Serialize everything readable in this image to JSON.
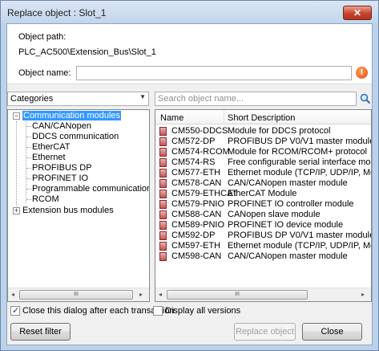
{
  "window": {
    "title": "Replace object : Slot_1",
    "close_label": "✕"
  },
  "header": {
    "path_label": "Object path:",
    "path_value": "PLC_AC500\\Extension_Bus\\Slot_1",
    "name_label": "Object name:",
    "name_value": "",
    "warning_symbol": "!"
  },
  "filter": {
    "category_selected": "Categories",
    "search_placeholder": "Search object name..."
  },
  "tree": {
    "nodes": [
      {
        "label": "Communication modules",
        "expanded": true,
        "selected": true
      },
      {
        "label": "CAN/CANopen"
      },
      {
        "label": "DDCS communication"
      },
      {
        "label": "EtherCAT"
      },
      {
        "label": "Ethernet"
      },
      {
        "label": "PROFIBUS DP"
      },
      {
        "label": "PROFINET IO"
      },
      {
        "label": "Programmable communication modul"
      },
      {
        "label": "RCOM"
      },
      {
        "label": "Extension bus modules",
        "expanded": false
      }
    ]
  },
  "list": {
    "columns": [
      "Name",
      "Short Description"
    ],
    "rows": [
      {
        "name": "CM550-DDCS",
        "desc": "Module for DDCS protocol"
      },
      {
        "name": "CM572-DP",
        "desc": "PROFIBUS DP V0/V1 master module"
      },
      {
        "name": "CM574-RCOM",
        "desc": "Module for RCOM/RCOM+ protocol"
      },
      {
        "name": "CM574-RS",
        "desc": "Free configurable serial interface module"
      },
      {
        "name": "CM577-ETH",
        "desc": "Ethernet module (TCP/IP, UDP/IP, Modbus TCP"
      },
      {
        "name": "CM578-CAN",
        "desc": "CAN/CANopen master module"
      },
      {
        "name": "CM579-ETHCAT",
        "desc": "EtherCAT Module"
      },
      {
        "name": "CM579-PNIO",
        "desc": "PROFINET IO controller module"
      },
      {
        "name": "CM588-CAN",
        "desc": "CANopen slave module"
      },
      {
        "name": "CM589-PNIO",
        "desc": "PROFINET IO device module"
      },
      {
        "name": "CM592-DP",
        "desc": "PROFIBUS DP V0/V1 master module"
      },
      {
        "name": "CM597-ETH",
        "desc": "Ethernet module (TCP/IP, UDP/IP, Modbus TCP"
      },
      {
        "name": "CM598-CAN",
        "desc": "CAN/CANopen master module"
      }
    ]
  },
  "scroll": {
    "left_arrow": "◂",
    "right_arrow": "▸",
    "thumb_grip": "III"
  },
  "options": {
    "close_after_label": "Close this dialog after each transaction",
    "close_after_checked": true,
    "display_all_label": "Display all versions",
    "display_all_checked": false
  },
  "buttons": {
    "reset_filter": "Reset filter",
    "replace_object": "Replace object",
    "close": "Close"
  }
}
